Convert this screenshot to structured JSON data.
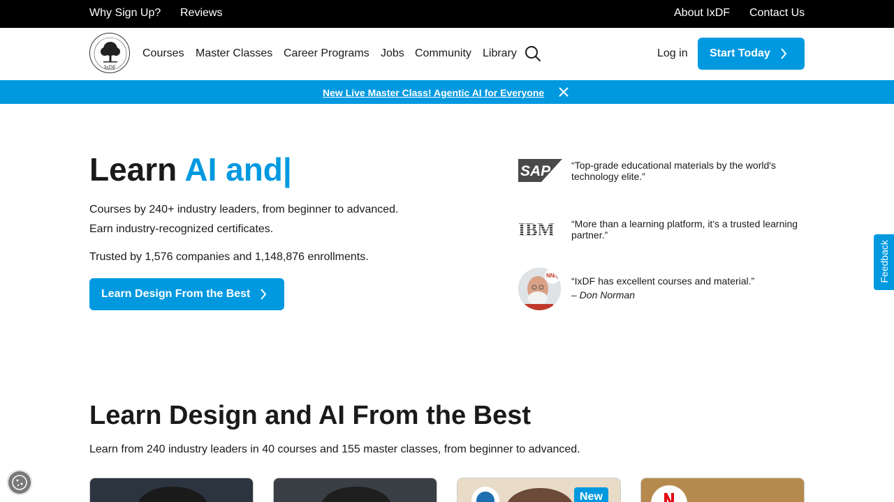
{
  "topbar": {
    "why_sign_up": "Why Sign Up?",
    "reviews": "Reviews",
    "about": "About IxDF",
    "contact": "Contact Us"
  },
  "nav": {
    "logo_text": "IxDF",
    "courses": "Courses",
    "master_classes": "Master Classes",
    "career_programs": "Career Programs",
    "jobs": "Jobs",
    "community": "Community",
    "library": "Library",
    "login": "Log in",
    "start_today": "Start Today"
  },
  "banner": {
    "text": "New Live Master Class! Agentic AI for Everyone"
  },
  "hero": {
    "title_prefix": "Learn",
    "title_accent": "AI and|",
    "line1": "Courses by 240+ industry leaders, from beginner to advanced.",
    "line2": "Earn industry-recognized certificates.",
    "line3": "Trusted by 1,576 companies and 1,148,876 enrollments.",
    "cta": "Learn Design From the Best"
  },
  "testimonials": [
    {
      "logo": "SAP",
      "quote": "“Top-grade educational materials by the world's technology elite.”"
    },
    {
      "logo": "IBM",
      "quote": "“More than a learning platform, it's a trusted learning partner.”"
    },
    {
      "logo": "NN/g",
      "quote": "“IxDF has excellent courses and material.”",
      "author": "– Don Norman"
    }
  ],
  "feedback": "Feedback",
  "section": {
    "title": "Learn Design and AI From the Best",
    "subtitle": "Learn from 240 industry leaders in 40 courses and 155 master classes, from beginner to advanced."
  },
  "cards": {
    "new_badge": "New"
  },
  "colors": {
    "accent": "#0099e0",
    "topbar_bg": "#000000",
    "text": "#1a1a1a"
  }
}
